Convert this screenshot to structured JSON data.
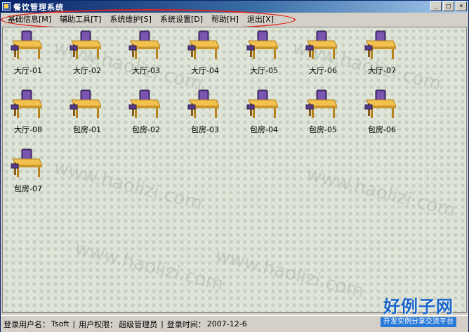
{
  "window": {
    "title": "餐饮管理系统",
    "buttons": {
      "minimize": "_",
      "maximize": "□",
      "close": "×"
    }
  },
  "menu": [
    {
      "label": "基础信息[M]"
    },
    {
      "label": "辅助工具[T]"
    },
    {
      "label": "系统维护[S]"
    },
    {
      "label": "系统设置[D]"
    },
    {
      "label": "帮助[H]"
    },
    {
      "label": "退出[X]"
    }
  ],
  "tables": [
    {
      "label": "大厅-01"
    },
    {
      "label": "大厅-02"
    },
    {
      "label": "大厅-03"
    },
    {
      "label": "大厅-04"
    },
    {
      "label": "大厅-05"
    },
    {
      "label": "大厅-06"
    },
    {
      "label": "大厅-07"
    },
    {
      "label": "大厅-08"
    },
    {
      "label": "包房-01"
    },
    {
      "label": "包房-02"
    },
    {
      "label": "包房-03"
    },
    {
      "label": "包房-04"
    },
    {
      "label": "包房-05"
    },
    {
      "label": "包房-06"
    },
    {
      "label": "包房-07"
    }
  ],
  "watermark": "www.haolizi.com",
  "status": {
    "user_label": "登录用户名：",
    "user": "Tsoft",
    "separator": "|",
    "role_label": "用户权限：",
    "role": "超级管理员",
    "time_label": "登录时间：",
    "time": "2007-12-6"
  },
  "brand": {
    "title": "好例子网",
    "subtitle": "开发实例分享交流平台"
  },
  "colors": {
    "titlebar_start": "#0a246a",
    "titlebar_end": "#a6caf0",
    "highlight": "#e2231a",
    "content_bg": "#dfe5d9",
    "brand_blue": "#1a66c8"
  }
}
